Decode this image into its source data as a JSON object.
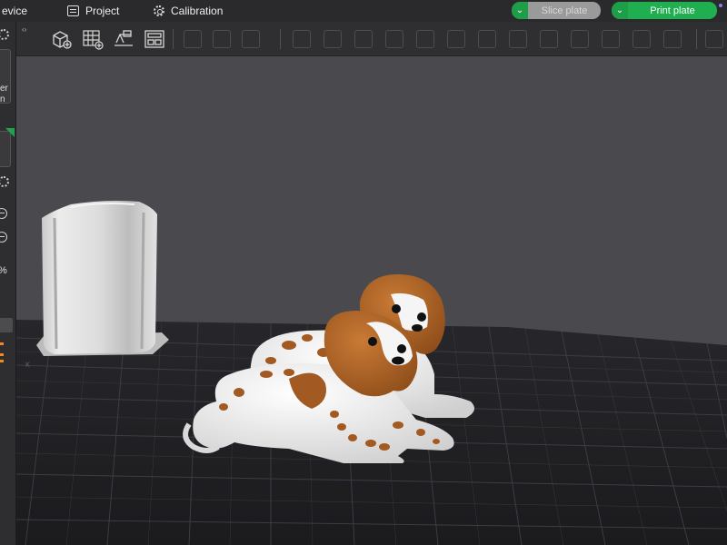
{
  "topbar": {
    "tabs": [
      {
        "label": "evice",
        "icon": "device-icon"
      },
      {
        "label": "Project",
        "icon": "project-icon"
      },
      {
        "label": "Calibration",
        "icon": "calibration-gear-icon"
      }
    ],
    "slice_label": "Slice plate",
    "print_label": "Print plate",
    "dropdown_glyph": "⌄",
    "accent_color": "#1fae50",
    "disabled_color": "#9a9a9a"
  },
  "leftpanel": {
    "text_lines": [
      "er",
      "n"
    ],
    "percent_glyph": "%"
  },
  "toolbar": {
    "collapse_glyph": "‹›",
    "icons": [
      "add-cube-icon",
      "add-plate-grid-icon",
      "auto-orient-icon",
      "arrange-icon"
    ]
  },
  "viewport": {
    "objects": [
      "wick-tower-model",
      "dog-model-back",
      "dog-model-front"
    ],
    "plate_marking": "ĸ"
  }
}
